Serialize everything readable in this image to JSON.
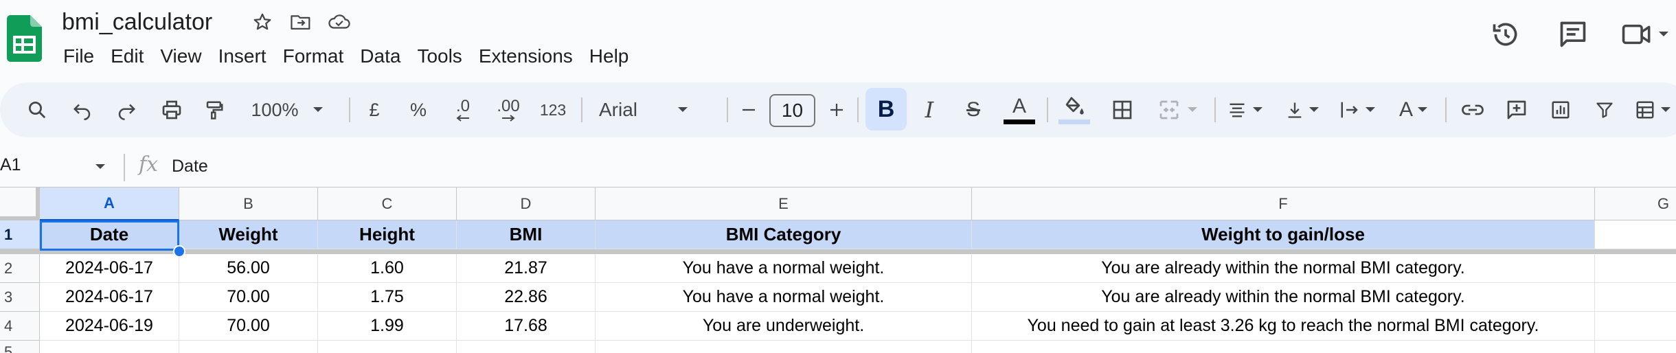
{
  "app": {
    "title": "bmi_calculator",
    "brand_color": "#0f9d58",
    "accent_color": "#0b57d0"
  },
  "menu": [
    "File",
    "Edit",
    "View",
    "Insert",
    "Format",
    "Data",
    "Tools",
    "Extensions",
    "Help"
  ],
  "toolbar": {
    "zoom": "100%",
    "currency": "£",
    "percent": "%",
    "decrease_decimals": ".0",
    "increase_decimals": ".00",
    "number_format": "123",
    "font": "Arial",
    "font_size": "10",
    "bold": "B",
    "italic": "I",
    "strikethrough": "S",
    "text_color": "A",
    "text_rotation": "A"
  },
  "formula_bar": {
    "cell_ref": "A1",
    "fx": "fx",
    "value": "Date"
  },
  "columns": [
    "A",
    "B",
    "C",
    "D",
    "E",
    "F",
    "G"
  ],
  "rows": [
    "1",
    "2",
    "3",
    "4",
    "5"
  ],
  "sheet": {
    "header": [
      "Date",
      "Weight",
      "Height",
      "BMI",
      "BMI Category",
      "Weight to gain/lose"
    ],
    "data": [
      [
        "2024-06-17",
        "56.00",
        "1.60",
        "21.87",
        "You have a normal weight.",
        "You are already within the normal BMI category."
      ],
      [
        "2024-06-17",
        "70.00",
        "1.75",
        "22.86",
        "You have a normal weight.",
        "You are already within the normal BMI category."
      ],
      [
        "2024-06-19",
        "70.00",
        "1.99",
        "17.68",
        "You are underweight.",
        "You need to gain at least 3.26 kg to reach the normal BMI category."
      ]
    ]
  },
  "icons": [
    "sheets-logo-icon",
    "star-icon",
    "move-to-folder-icon",
    "cloud-saved-icon",
    "history-icon",
    "comments-icon",
    "meet-camera-icon",
    "search-icon",
    "undo-icon",
    "redo-icon",
    "print-icon",
    "paint-format-icon",
    "fill-color-icon",
    "borders-icon",
    "merge-cells-icon",
    "align-icon",
    "valign-icon",
    "text-wrap-icon",
    "link-icon",
    "add-comment-icon",
    "insert-chart-icon",
    "filter-icon",
    "table-view-icon"
  ]
}
